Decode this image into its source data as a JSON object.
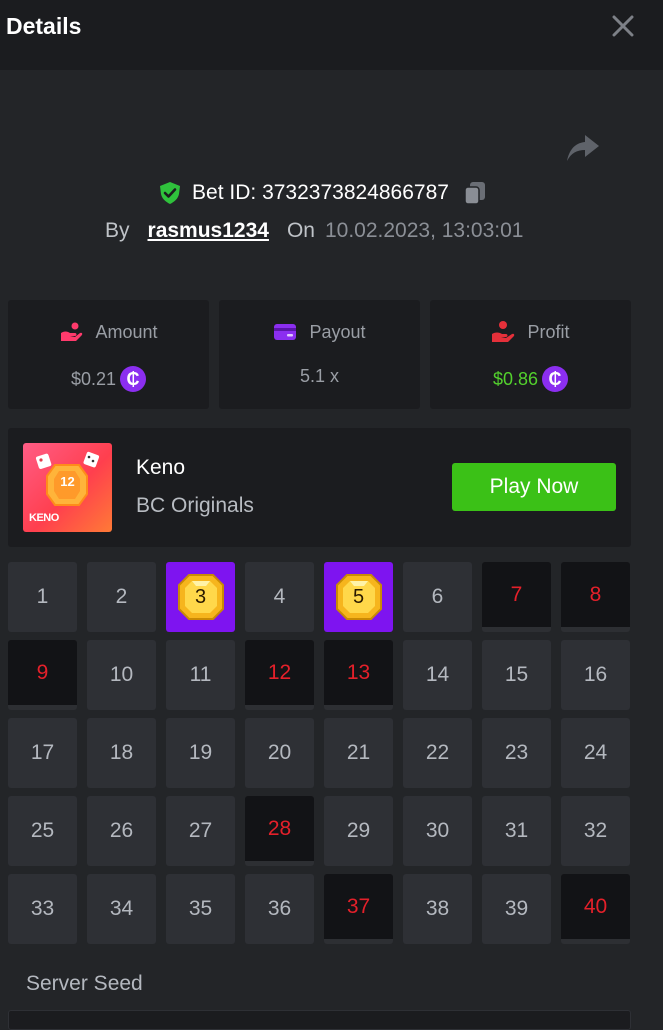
{
  "header": {
    "title": "Details"
  },
  "bet": {
    "id_text": "Bet ID: 3732373824866787",
    "by_label": "By",
    "username": "rasmus1234",
    "on_label": "On",
    "datetime": "10.02.2023, 13:03:01"
  },
  "stats": {
    "amount": {
      "label": "Amount",
      "value": "$0.21",
      "coin": "₵"
    },
    "payout": {
      "label": "Payout",
      "value": "5.1 x"
    },
    "profit": {
      "label": "Profit",
      "value": "$0.86",
      "coin": "₵"
    }
  },
  "game": {
    "thumb_label": "KENO",
    "thumb_number": "12",
    "name": "Keno",
    "provider": "BC Originals",
    "play_label": "Play Now"
  },
  "board": {
    "numbers": [
      "1",
      "2",
      "3",
      "4",
      "5",
      "6",
      "7",
      "8",
      "9",
      "10",
      "11",
      "12",
      "13",
      "14",
      "15",
      "16",
      "17",
      "18",
      "19",
      "20",
      "21",
      "22",
      "23",
      "24",
      "25",
      "26",
      "27",
      "28",
      "29",
      "30",
      "31",
      "32",
      "33",
      "34",
      "35",
      "36",
      "37",
      "38",
      "39",
      "40"
    ],
    "hits": [
      3,
      5
    ],
    "misses": [
      7,
      8,
      9,
      12,
      13,
      28,
      37,
      40
    ]
  },
  "seed": {
    "label": "Server Seed"
  },
  "colors": {
    "accent_purple": "#7e14f0",
    "play_green": "#3bc117",
    "profit_green": "#53d12d",
    "miss_red": "#e4202a"
  },
  "icons": {
    "close": "close-icon",
    "share": "share-icon",
    "verified": "shield-check-icon",
    "copy": "copy-icon",
    "amount": "hand-coins-icon",
    "payout": "card-icon",
    "profit": "hand-payout-icon"
  }
}
